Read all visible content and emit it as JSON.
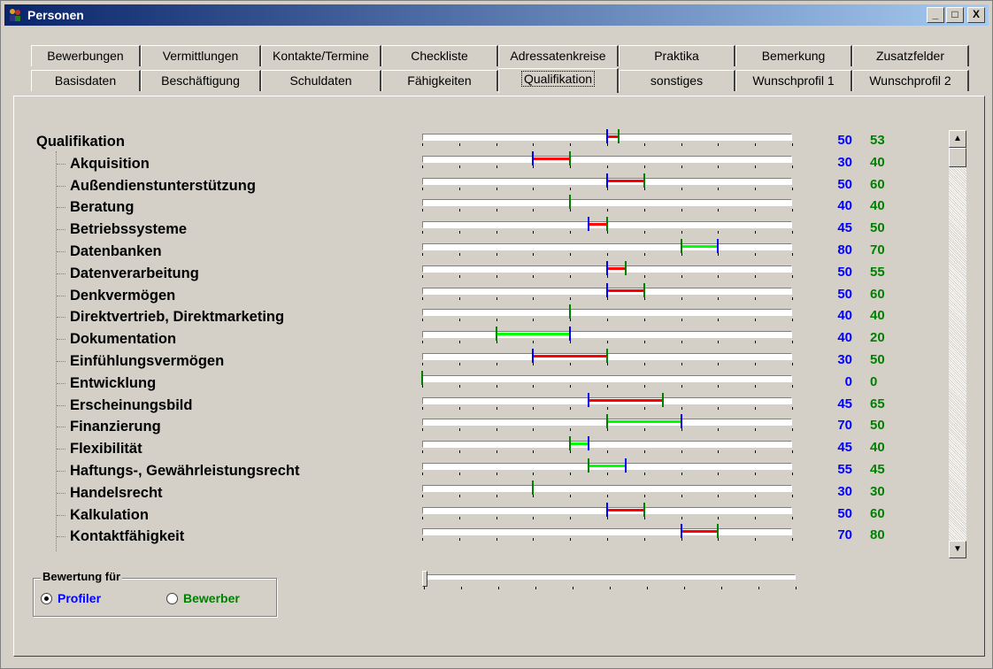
{
  "window": {
    "title": "Personen",
    "minimize": "_",
    "maximize": "□",
    "close": "X"
  },
  "tabs_row1": [
    "Bewerbungen",
    "Vermittlungen",
    "Kontakte/Termine",
    "Checkliste",
    "Adressatenkreise",
    "Praktika",
    "Bemerkung",
    "Zusatzfelder"
  ],
  "tabs_row2": [
    "Basisdaten",
    "Beschäftigung",
    "Schuldaten",
    "Fähigkeiten",
    "Qualifikation",
    "sonstiges",
    "Wunschprofil 1",
    "Wunschprofil 2"
  ],
  "active_tab": "Qualifikation",
  "colors": {
    "profiler": "#0000ff",
    "bewerber": "#008000",
    "gap_red": "#ff0000",
    "gap_green": "#00ff00"
  },
  "rows": [
    {
      "label": "Qualifikation",
      "profiler": "50",
      "bewerber": "53",
      "p": 50,
      "b": 53,
      "level": 0
    },
    {
      "label": "Akquisition",
      "profiler": "30",
      "bewerber": "40",
      "p": 30,
      "b": 40,
      "level": 1
    },
    {
      "label": "Außendienstunterstützung",
      "profiler": "50",
      "bewerber": "60",
      "p": 50,
      "b": 60,
      "level": 1
    },
    {
      "label": "Beratung",
      "profiler": "40",
      "bewerber": "40",
      "p": 40,
      "b": 40,
      "level": 1
    },
    {
      "label": "Betriebssysteme",
      "profiler": "45",
      "bewerber": "50",
      "p": 45,
      "b": 50,
      "level": 1
    },
    {
      "label": "Datenbanken",
      "profiler": "80",
      "bewerber": "70",
      "p": 80,
      "b": 70,
      "level": 1
    },
    {
      "label": "Datenverarbeitung",
      "profiler": "50",
      "bewerber": "55",
      "p": 50,
      "b": 55,
      "level": 1
    },
    {
      "label": "Denkvermögen",
      "profiler": "50",
      "bewerber": "60",
      "p": 50,
      "b": 60,
      "level": 1
    },
    {
      "label": "Direktvertrieb, Direktmarketing",
      "profiler": "40",
      "bewerber": "40",
      "p": 40,
      "b": 40,
      "level": 1
    },
    {
      "label": "Dokumentation",
      "profiler": "40",
      "bewerber": "20",
      "p": 40,
      "b": 20,
      "level": 1
    },
    {
      "label": "Einfühlungsvermögen",
      "profiler": "30",
      "bewerber": "50",
      "p": 30,
      "b": 50,
      "level": 1
    },
    {
      "label": "Entwicklung",
      "profiler": "0",
      "bewerber": "0",
      "p": 0,
      "b": 0,
      "level": 1
    },
    {
      "label": "Erscheinungsbild",
      "profiler": "45",
      "bewerber": "65",
      "p": 45,
      "b": 65,
      "level": 1
    },
    {
      "label": "Finanzierung",
      "profiler": "70",
      "bewerber": "50",
      "p": 70,
      "b": 50,
      "level": 1
    },
    {
      "label": "Flexibilität",
      "profiler": "45",
      "bewerber": "40",
      "p": 45,
      "b": 40,
      "level": 1
    },
    {
      "label": "Haftungs-, Gewährleistungsrecht",
      "profiler": "55",
      "bewerber": "45",
      "p": 55,
      "b": 45,
      "level": 1
    },
    {
      "label": "Handelsrecht",
      "profiler": "30",
      "bewerber": "30",
      "p": 30,
      "b": 30,
      "level": 1
    },
    {
      "label": "Kalkulation",
      "profiler": "50",
      "bewerber": "60",
      "p": 50,
      "b": 60,
      "level": 1
    },
    {
      "label": "Kontaktfähigkeit",
      "profiler": "70",
      "bewerber": "80",
      "p": 70,
      "b": 80,
      "level": 1
    }
  ],
  "scale": {
    "min": 0,
    "max": 100
  },
  "rating": {
    "legend": "Bewertung für",
    "profiler_label": "Profiler",
    "bewerber_label": "Bewerber",
    "selected": "Profiler"
  },
  "slider": {
    "value": 0
  },
  "scrollbar": {
    "up": "▲",
    "down": "▼"
  }
}
